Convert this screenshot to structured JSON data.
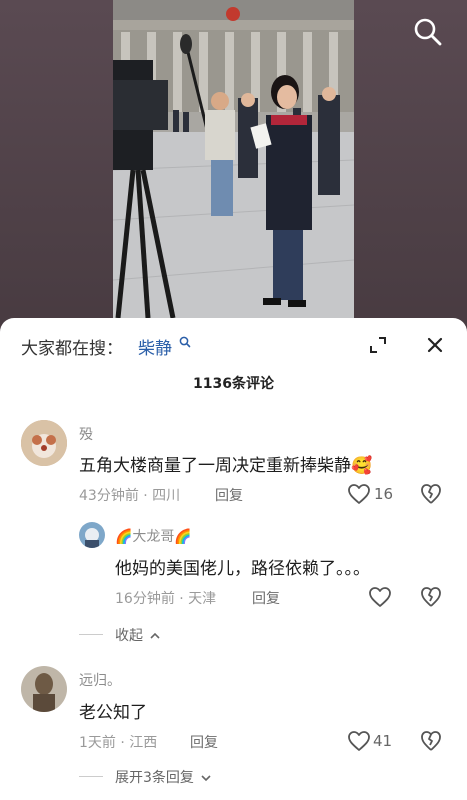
{
  "header": {
    "hot_prefix": "大家都在搜：",
    "hot_term": "柴静"
  },
  "comments_count_label": "1136条评论",
  "comments": [
    {
      "user": "殁",
      "text": "五角大楼商量了一周决定重新捧柴静",
      "emoji": "🥰",
      "time_location": "43分钟前 · 四川",
      "reply_label": "回复",
      "likes": "16",
      "replies": [
        {
          "user": "🌈大龙哥🌈",
          "text": "他妈的美国佬儿，路径依赖了。。。",
          "time_location": "16分钟前 · 天津",
          "reply_label": "回复"
        }
      ],
      "collapse_label": "收起"
    },
    {
      "user": "远归。",
      "text": "老公知了",
      "time_location": "1天前 · 江西",
      "reply_label": "回复",
      "likes": "41",
      "expand_label": "展开3条回复"
    }
  ],
  "colors": {
    "link": "#2a5ea8",
    "sheet": "#ffffff",
    "backdrop": "#4a3e44"
  }
}
